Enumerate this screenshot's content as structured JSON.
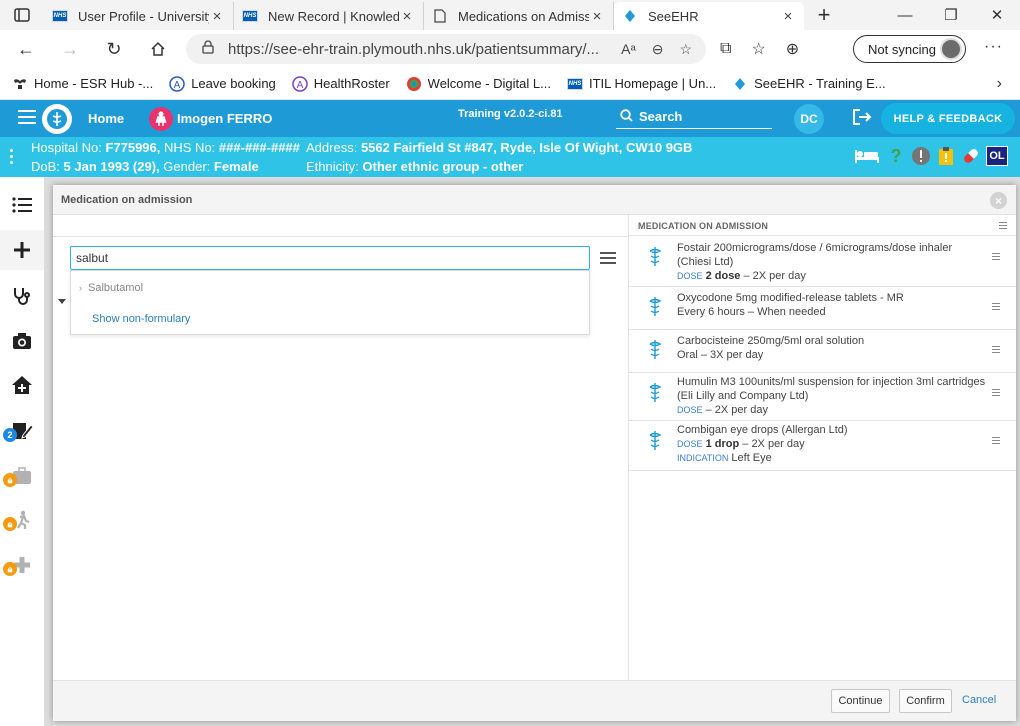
{
  "browser": {
    "tabs": [
      {
        "title": "User Profile - University",
        "icon": "nhs-icon"
      },
      {
        "title": "New Record | Knowledg",
        "icon": "nhs-icon"
      },
      {
        "title": "Medications on Admiss",
        "icon": "page-icon"
      },
      {
        "title": "SeeEHR",
        "icon": "seeehr-icon"
      }
    ],
    "url": "https://see-ehr-train.plymouth.nhs.uk/patientsummary/...",
    "sync_label": "Not syncing",
    "bookmarks": [
      {
        "label": "Home - ESR Hub -...",
        "icon": "esr-icon"
      },
      {
        "label": "Leave booking",
        "icon": "a-circle-icon"
      },
      {
        "label": "HealthRoster",
        "icon": "a-circle-icon"
      },
      {
        "label": "Welcome - Digital L...",
        "icon": "digital-icon"
      },
      {
        "label": "ITIL Homepage | Un...",
        "icon": "nhs-icon"
      },
      {
        "label": "SeeEHR - Training E...",
        "icon": "seeehr-icon"
      }
    ]
  },
  "app": {
    "home_label": "Home",
    "patient_name": "Imogen FERRO",
    "version": "Training v2.0.2-ci.81",
    "search_label": "Search",
    "user_initials": "DC",
    "help_label": "HELP & FEEDBACK",
    "colors": {
      "header": "#1e9bd7",
      "patient_bar": "#30c3e8",
      "accent": "#33aee6"
    }
  },
  "patient": {
    "hospital_no_label": "Hospital No:",
    "hospital_no": "F775996,",
    "nhs_no_label": "NHS No:",
    "nhs_no": "###-###-####",
    "dob_label": "DoB:",
    "dob": "5 Jan 1993 (29),",
    "gender_label": "Gender:",
    "gender": "Female",
    "address_label": "Address:",
    "address": "5562 Fairfield St #847, Ryde, Isle Of Wight, CW10 9GB",
    "ethnicity_label": "Ethnicity:",
    "ethnicity": "Other ethnic group - other",
    "flag_badge": "OL"
  },
  "sidebar": {
    "badge_count": "2"
  },
  "modal": {
    "title": "Medication on admission",
    "search_value": "salbut",
    "suggestion": "Salbutamol",
    "show_non_formulary": "Show non-formulary",
    "list_title": "MEDICATION ON ADMISSION",
    "medications": [
      {
        "name": "Fostair 200micrograms/dose / 6micrograms/dose inhaler (Chiesi Ltd)",
        "tag": "DOSE",
        "dose": "2 dose",
        "freq": "– 2X per day"
      },
      {
        "name": "Oxycodone 5mg modified-release tablets - MR",
        "detail": "Every 6 hours – When needed"
      },
      {
        "name": "Carbocisteine 250mg/5ml oral solution",
        "detail": "Oral – 3X per day"
      },
      {
        "name": "Humulin M3 100units/ml suspension for injection 3ml cartridges (Eli Lilly and Company Ltd)",
        "tag": "DOSE",
        "freq": "– 2X per day"
      },
      {
        "name": "Combigan eye drops (Allergan Ltd)",
        "tag": "DOSE",
        "dose": "1 drop",
        "freq": "– 2X per day",
        "indication_tag": "INDICATION",
        "indication": "Left Eye"
      }
    ],
    "buttons": {
      "continue": "Continue",
      "confirm": "Confirm",
      "cancel": "Cancel"
    }
  }
}
